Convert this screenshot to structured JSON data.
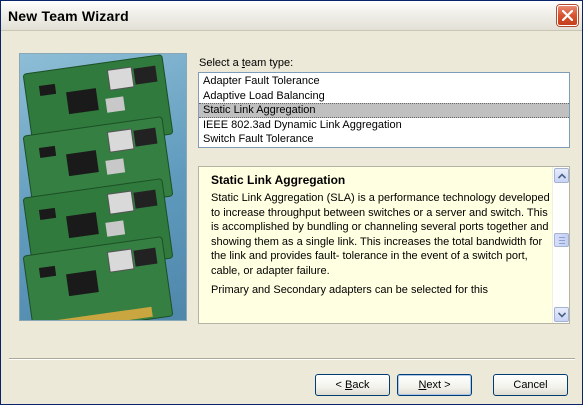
{
  "window": {
    "title": "New Team Wizard"
  },
  "team_type": {
    "label_before": "Select a ",
    "label_accel": "t",
    "label_after": "eam type:",
    "options": [
      "Adapter Fault Tolerance",
      "Adaptive Load Balancing",
      "Static Link Aggregation",
      "IEEE 802.3ad Dynamic Link Aggregation",
      "Switch Fault Tolerance"
    ],
    "selected": "Static Link Aggregation"
  },
  "description": {
    "title": "Static Link Aggregation",
    "paragraph1": "Static Link Aggregation (SLA) is a performance technology developed to increase throughput between switches or a server and switch. This is accomplished by bundling or channeling several ports together and showing them as a single link. This increases the total bandwidth for the link and provides fault- tolerance in the event of a switch port, cable, or adapter failure.",
    "paragraph2": "Primary and Secondary adapters can be selected for this"
  },
  "buttons": {
    "back_prefix": "< ",
    "back_accel": "B",
    "back_rest": "ack",
    "next_accel": "N",
    "next_rest": "ext >",
    "cancel": "Cancel"
  },
  "icons": {
    "close": "close-icon",
    "scroll_up": "scroll-up-arrow-icon",
    "scroll_down": "scroll-down-arrow-icon",
    "picture": "network-adapter-cards-illustration"
  },
  "colors": {
    "close_button": "#d7522f",
    "description_background": "#ffffe1",
    "selected_item": "#c0c0c0"
  }
}
